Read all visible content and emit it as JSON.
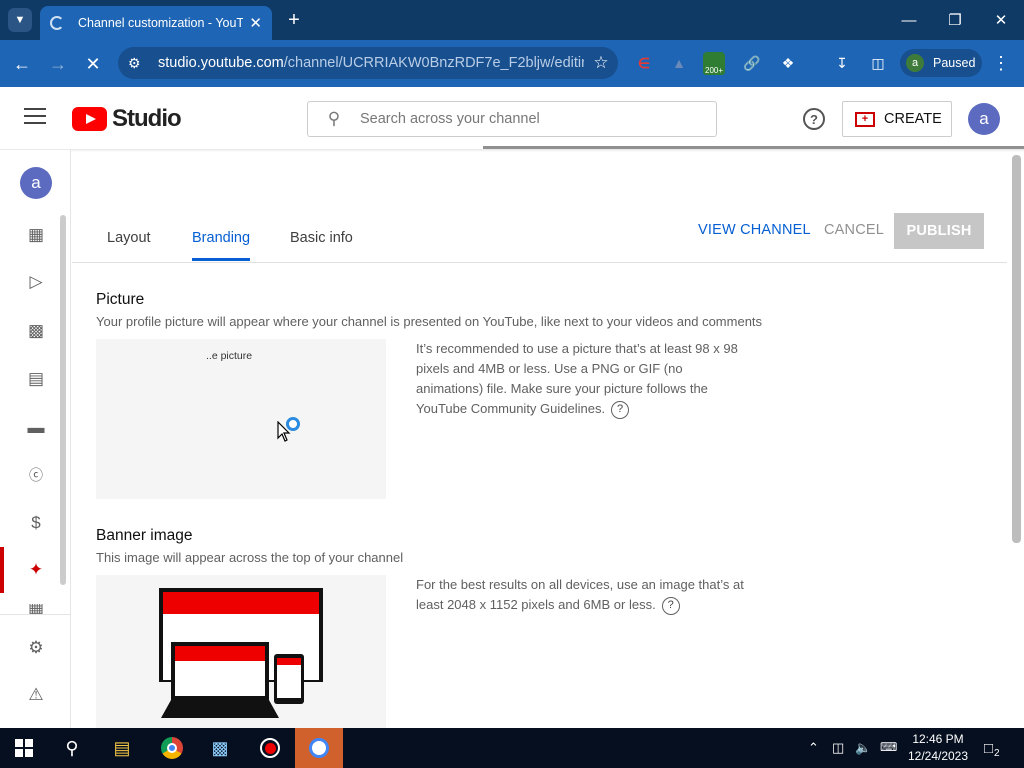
{
  "browser": {
    "tab_title": "Channel customization - YouTube Studio",
    "url_host": "studio.youtube.com",
    "url_path": "/channel/UCRRIAKW0BnzRDF7e_F2bljw/editin...",
    "profile_initial": "a",
    "profile_status": "Paused",
    "extension_badge": "200+"
  },
  "header": {
    "logo_text": "Studio",
    "search_placeholder": "Search across your channel",
    "create_label": "CREATE",
    "avatar_initial": "a"
  },
  "sidebar": {
    "avatar_initial": "a",
    "items": [
      "dashboard-icon",
      "content-icon",
      "analytics-icon",
      "comments-icon",
      "subtitles-icon",
      "copyright-icon",
      "earn-icon",
      "customization-icon",
      "audio-library-icon",
      "settings-icon",
      "feedback-icon"
    ],
    "active": "customization"
  },
  "tabs": [
    {
      "label": "Layout"
    },
    {
      "label": "Branding"
    },
    {
      "label": "Basic info"
    }
  ],
  "actions": {
    "view_channel": "VIEW CHANNEL",
    "cancel": "CANCEL",
    "publish": "PUBLISH"
  },
  "picture": {
    "title": "Picture",
    "subtitle": "Your profile picture will appear where your channel is presented on YouTube, like next to your videos and comments",
    "preview_label": "..e picture",
    "help_lines": [
      "It’s recommended to use a picture that’s at least 98 x 98",
      "pixels and 4MB or less. Use a PNG or GIF (no",
      "animations) file. Make sure your picture follows the",
      "YouTube Community Guidelines."
    ]
  },
  "banner": {
    "title": "Banner image",
    "subtitle": "This image will appear across the top of your channel",
    "help_lines": [
      "For the best results on all devices, use an image that’s at",
      "least 2048 x 1152 pixels and 6MB or less."
    ]
  },
  "taskbar": {
    "time": "12:46 PM",
    "date": "12/24/2023",
    "notification_count": "2"
  },
  "colors": {
    "accent": "#065fd4",
    "brand_red": "#ff0000",
    "chrome_frame": "#103a66",
    "chrome_toolbar": "#1e65b5"
  }
}
